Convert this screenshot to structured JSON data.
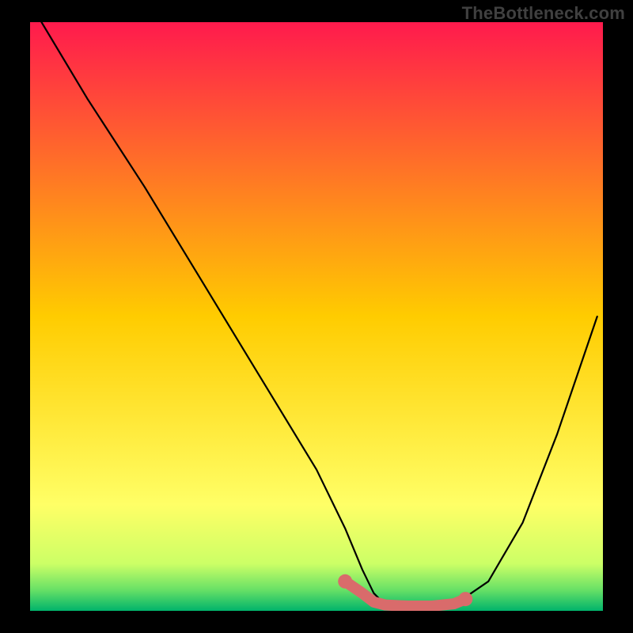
{
  "watermark": "TheBottleneck.com",
  "colors": {
    "background": "#000000",
    "gradient_stops": [
      {
        "offset": 0.0,
        "color": "#ff1a4d"
      },
      {
        "offset": 0.5,
        "color": "#ffcc00"
      },
      {
        "offset": 0.82,
        "color": "#ffff66"
      },
      {
        "offset": 0.92,
        "color": "#ccff66"
      },
      {
        "offset": 0.965,
        "color": "#66e066"
      },
      {
        "offset": 1.0,
        "color": "#00b36b"
      }
    ],
    "curve": "#000000",
    "marker": "#d96b6b"
  },
  "chart_data": {
    "type": "line",
    "title": "",
    "xlabel": "",
    "ylabel": "",
    "xlim": [
      0,
      100
    ],
    "ylim": [
      0,
      100
    ],
    "series": [
      {
        "name": "bottleneck-curve",
        "x": [
          2,
          10,
          20,
          30,
          40,
          50,
          55,
          58,
          60,
          62,
          66,
          70,
          74,
          80,
          86,
          92,
          99
        ],
        "y": [
          100,
          87,
          72,
          56,
          40,
          24,
          14,
          7,
          3,
          1,
          0.5,
          0.5,
          1,
          5,
          15,
          30,
          50
        ]
      }
    ],
    "highlight_segment": {
      "name": "optimal-zone",
      "x": [
        55,
        58,
        60,
        62,
        66,
        70,
        74,
        76
      ],
      "y": [
        5,
        3,
        1.5,
        1,
        0.8,
        0.8,
        1.2,
        2
      ]
    }
  }
}
